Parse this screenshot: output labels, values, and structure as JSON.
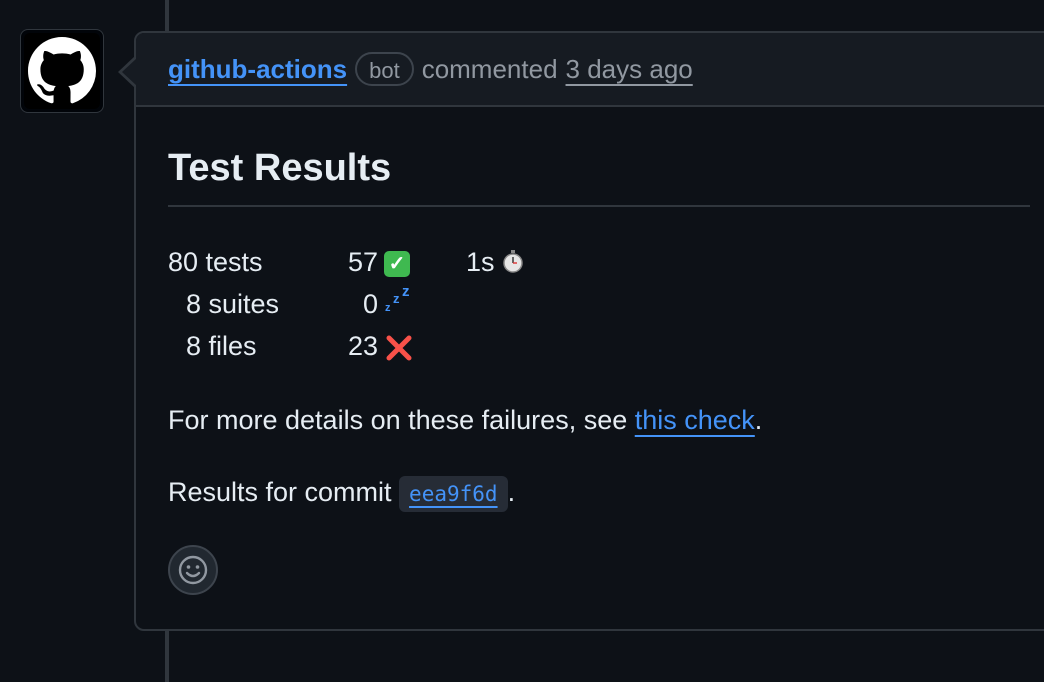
{
  "comment": {
    "author": "github-actions",
    "badge": "bot",
    "action": "commented",
    "time": "3 days ago"
  },
  "body": {
    "title": "Test Results",
    "stats": {
      "tests": "80 tests",
      "passed": "57",
      "duration": "1s",
      "suites": "8 suites",
      "skipped": "0",
      "files": "8 files",
      "failed": "23"
    },
    "details_prefix": "For more details on these failures, see ",
    "details_link": "this check",
    "details_suffix": ".",
    "commit_prefix": "Results for commit ",
    "commit_sha": "eea9f6d",
    "commit_suffix": "."
  },
  "icons": {
    "passed": "check-mark-icon",
    "skipped": "sleep-icon",
    "failed": "cross-mark-icon",
    "duration": "stopwatch-icon",
    "reaction": "smiley-icon",
    "avatar": "github-octocat-icon"
  },
  "colors": {
    "link": "#4493f8",
    "pass": "#3fb950",
    "fail": "#f85149",
    "background": "#0d1117"
  }
}
